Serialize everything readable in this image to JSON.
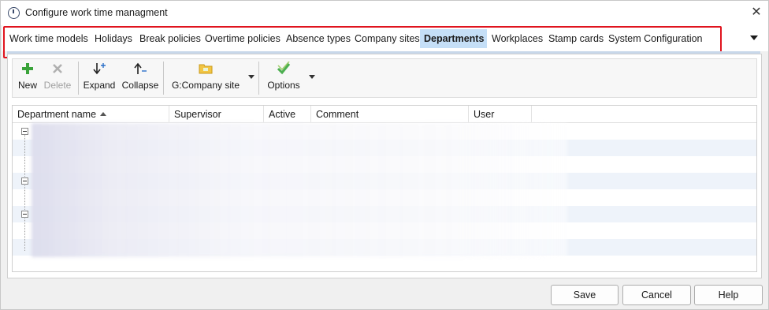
{
  "window": {
    "title": "Configure work time managment"
  },
  "tabs": [
    {
      "label": "Work time models",
      "active": false
    },
    {
      "label": "Holidays",
      "active": false
    },
    {
      "label": "Break policies",
      "active": false
    },
    {
      "label": "Overtime policies",
      "active": false
    },
    {
      "label": "Absence types",
      "active": false
    },
    {
      "label": "Company sites",
      "active": false
    },
    {
      "label": "Departments",
      "active": true
    },
    {
      "label": "Workplaces",
      "active": false
    },
    {
      "label": "Stamp cards",
      "active": false
    },
    {
      "label": "System Configuration",
      "active": false
    }
  ],
  "toolbar": {
    "new_label": "New",
    "delete_label": "Delete",
    "expand_label": "Expand",
    "collapse_label": "Collapse",
    "site_label": "G:Company site",
    "options_label": "Options"
  },
  "grid": {
    "columns": [
      "Department name",
      "Supervisor",
      "Active",
      "Comment",
      "User"
    ],
    "sort_column": "Department name",
    "sort_direction": "ascending"
  },
  "buttons": {
    "save_label": "Save",
    "cancel_label": "Cancel",
    "help_label": "Help"
  },
  "colors": {
    "highlight_border": "#e0141e",
    "active_tab": "#c5dff7",
    "new_icon": "#3aa33a",
    "options_icon": "#4caf50"
  }
}
